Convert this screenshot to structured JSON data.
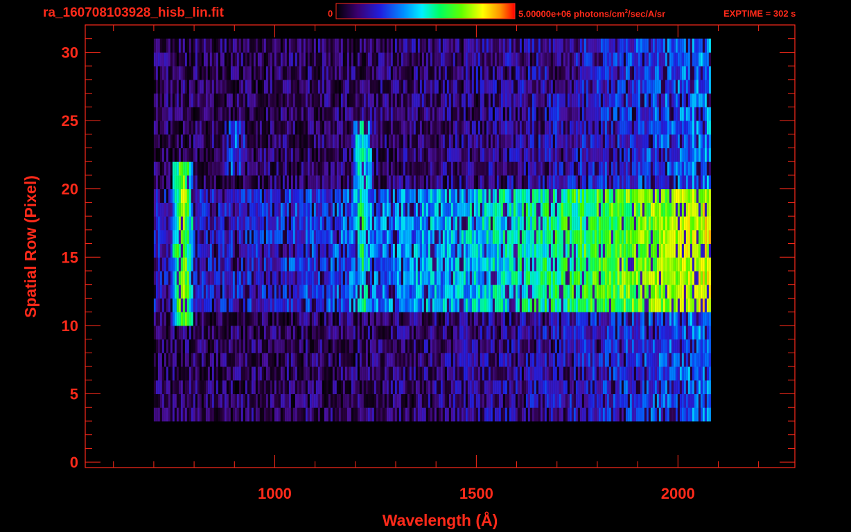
{
  "header": {
    "file_title": "ra_160708103928_hisb_lin.fit",
    "colorbar_min_label": "0",
    "colorbar_max_label_pre": "5.00000e+06 photons/cm",
    "colorbar_max_label_sup": "2",
    "colorbar_max_label_post": "/sec/A/sr",
    "exptime_label": "EXPTIME = 302 s"
  },
  "colors": {
    "axis": "#ff2a1a",
    "background": "#000000",
    "colormap": [
      "#000000",
      "#2a003f",
      "#4a10a0",
      "#2020e0",
      "#0070ff",
      "#00e0ff",
      "#00ff80",
      "#40ff00",
      "#c0ff00",
      "#ffff00",
      "#ff8000",
      "#ff0000"
    ]
  },
  "chart_data": {
    "type": "heatmap",
    "xlabel": "Wavelength (Å)",
    "ylabel": "Spatial Row (Pixel)",
    "xlim": [
      530,
      2290
    ],
    "ylim": [
      -0.4,
      32
    ],
    "x_ticks": [
      1000,
      1500,
      2000
    ],
    "x_tick_labels": [
      "1000",
      "1500",
      "2000"
    ],
    "y_ticks": [
      0,
      5,
      10,
      15,
      20,
      25,
      30
    ],
    "y_tick_labels": [
      "0",
      "5",
      "10",
      "15",
      "20",
      "25",
      "30"
    ],
    "colorbar": {
      "min": 0,
      "max": 5000000,
      "units": "photons/cm^2/sec/A/sr",
      "scale": "linear"
    },
    "data_x_range": [
      700,
      2080
    ],
    "data_rows": [
      3,
      30
    ],
    "bright_rows": [
      11,
      19
    ],
    "features": [
      {
        "wavelength": 770,
        "rows": [
          10,
          21
        ],
        "level": 0.72
      },
      {
        "wavelength": 1216,
        "rows": [
          11,
          24
        ],
        "level": 0.55
      },
      {
        "wavelength": 900,
        "rows": [
          21,
          24
        ],
        "level": 0.35
      }
    ],
    "grid": false
  }
}
